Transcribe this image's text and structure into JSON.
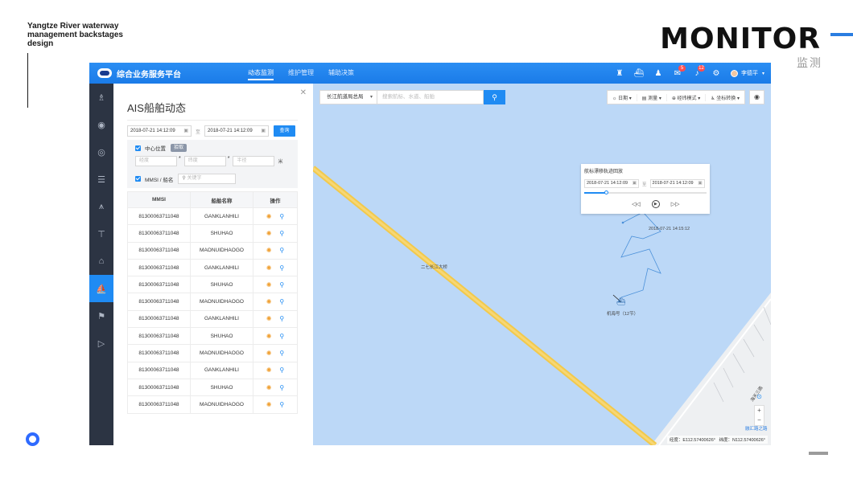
{
  "slide": {
    "brand_line1": "Yangtze River waterway",
    "brand_line2": "management backstages",
    "brand_line3": "design",
    "heading": "MONITOR",
    "subheading": "监测"
  },
  "app": {
    "title": "综合业务服务平台",
    "nav": [
      "动态监测",
      "维护管理",
      "辅助决策"
    ],
    "active_nav": 0,
    "badges": {
      "messages": "5",
      "alerts": "12"
    },
    "user": "李德平"
  },
  "panel": {
    "title": "AIS船舶动态",
    "start_date": "2018-07-21 14:12:09",
    "to": "至",
    "end_date": "2018-07-21 14:12:09",
    "query_label": "查询",
    "center_label": "中心位置",
    "pick_label": "拾取",
    "lng_placeholder": "经度",
    "lat_placeholder": "纬度",
    "radius_placeholder": "半径",
    "radius_unit": "米",
    "mmsi_label": "MMSI / 船名",
    "keyword_placeholder": "关键字",
    "columns": [
      "MMSI",
      "船舶名称",
      "操作"
    ],
    "rows": [
      [
        "81300063711048",
        "GANKLANHILI"
      ],
      [
        "81300063711048",
        "SHUHAO"
      ],
      [
        "81300063711048",
        "MAONUIDHAOGO"
      ],
      [
        "81300063711048",
        "GANKLANHILI"
      ],
      [
        "81300063711048",
        "SHUHAO"
      ],
      [
        "81300063711048",
        "MAONUIDHAOGO"
      ],
      [
        "81300063711048",
        "GANKLANHILI"
      ],
      [
        "81300063711048",
        "SHUHAO"
      ],
      [
        "81300063711048",
        "MAONUIDHAOGO"
      ],
      [
        "81300063711048",
        "GANKLANHILI"
      ],
      [
        "81300063711048",
        "SHUHAO"
      ],
      [
        "81300063711048",
        "MAONUIDHAOGO"
      ]
    ]
  },
  "map": {
    "bureau_select": "长江航道局总局",
    "search_placeholder": "搜索航标、水道、船舶",
    "tools": [
      "日期",
      "测量",
      "经纬模式",
      "坐标转换"
    ],
    "playback": {
      "title": "航标漂移轨迹回放",
      "start": "2018-07-21 14:12:09",
      "to": "至",
      "end": "2018-07-21 14:12:09",
      "progress": 0.18
    },
    "bridge_label": "二七长江大桥",
    "track_time": "2018-07-21 14:15:12",
    "ship_label": "机海号（12节）",
    "road_label": "海天三路",
    "place_label": "融汇路之路",
    "lng": "经度：E112.57400626°",
    "lat": "纬度：N112.57400626°"
  }
}
